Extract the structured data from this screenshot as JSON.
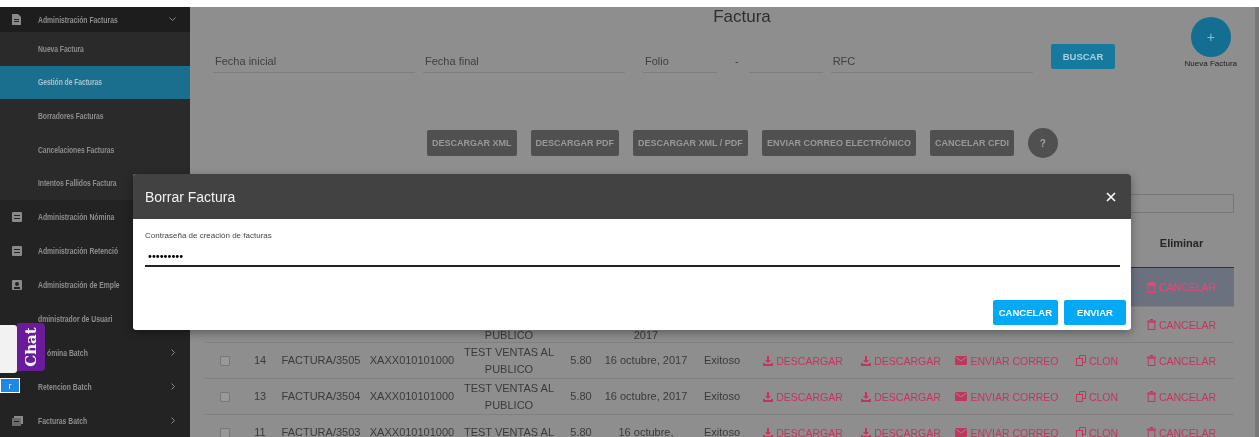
{
  "sidebar": {
    "items": [
      {
        "label": "Administración Facturas",
        "kind": "document",
        "expanded": true,
        "chevron": true,
        "children": [
          {
            "label": "Nueva Factura",
            "selected": false
          },
          {
            "label": "Gestión de Facturas",
            "selected": true
          },
          {
            "label": "Borradores Facturas",
            "selected": false
          },
          {
            "label": "Cancelaciones Facturas",
            "selected": false
          },
          {
            "label": "Intentos Fallidos Factura",
            "selected": false
          }
        ]
      },
      {
        "label": "Administración Nómina",
        "kind": "list"
      },
      {
        "label": "Administración Retenció",
        "kind": "list"
      },
      {
        "label": "Administración de Emple",
        "kind": "person"
      },
      {
        "label": "dministrador de Usuari",
        "kind": "none"
      },
      {
        "label": "ómina Batch",
        "kind": "covered",
        "expanded": false,
        "chevron": true
      },
      {
        "label": "Retencion Batch",
        "kind": "none",
        "expanded": false,
        "chevron": true
      },
      {
        "label": "Facturas Batch",
        "kind": "batch",
        "expanded": false,
        "chevron": true
      }
    ]
  },
  "chat": {
    "tab": "Chat",
    "button": "r"
  },
  "page": {
    "title": "Factura",
    "filters": [
      {
        "placeholder": "Fecha inicial",
        "kind": "wide"
      },
      {
        "placeholder": "Fecha final",
        "kind": "wide"
      },
      {
        "placeholder": "Folio",
        "kind": "short"
      },
      {
        "placeholder": "-",
        "kind": "dash"
      },
      {
        "kind": "short"
      },
      {
        "placeholder": "RFC",
        "kind": "wide"
      }
    ],
    "search_button": "BUSCAR",
    "fab": {
      "icon": "+",
      "label": "Nueva Factura"
    },
    "actions": [
      "DESCARGAR XML",
      "DESCARGAR PDF",
      "DESCARGAR XML / PDF",
      "ENVIAR CORREO ELECTRÓNICO",
      "CANCELAR CFDI"
    ],
    "help_button": "?"
  },
  "table": {
    "header": {
      "cancel": "Eliminar"
    },
    "rows": [
      {
        "selected": true,
        "cancel": "CANCELAR"
      },
      {
        "selected": false,
        "client": "PUBLICO",
        "date": "2017",
        "cancel": "CANCELAR"
      },
      {
        "selected": false,
        "checked": false,
        "number": "14",
        "folio": "FACTURA/3505",
        "rfc": "XAXX010101000",
        "client": "TEST VENTAS AL PUBLICO",
        "amount": "5.80",
        "date": "16 octubre, 2017",
        "status": "Exitoso",
        "xml": "DESCARGAR",
        "pdf": "DESCARGAR",
        "email": "ENVIAR CORREO",
        "clone": "CLON",
        "cancel": "CANCELAR"
      },
      {
        "selected": false,
        "checked": false,
        "number": "13",
        "folio": "FACTURA/3504",
        "rfc": "XAXX010101000",
        "client": "TEST VENTAS AL PUBLICO",
        "amount": "5.80",
        "date": "16 octubre, 2017",
        "status": "Exitoso",
        "xml": "DESCARGAR",
        "pdf": "DESCARGAR",
        "email": "ENVIAR CORREO",
        "clone": "CLON",
        "cancel": "CANCELAR"
      },
      {
        "selected": false,
        "checked": false,
        "number": "11",
        "folio": "FACTURA/3503",
        "rfc": "XAXX010101000",
        "client": "TEST VENTAS AL",
        "amount": "5.80",
        "date": "16 octubre,",
        "status": "Exitoso",
        "xml": "DESCARGAR",
        "pdf": "DESCARGAR",
        "email": "ENVIAR CORREO",
        "clone": "CLON",
        "cancel": "CANCELAR"
      }
    ]
  },
  "dialog": {
    "title": "Borrar Factura",
    "field_label": "Contraseña de creación de facturas",
    "field_value": "•••••••••",
    "buttons": [
      "CANCELAR",
      "ENVIAR"
    ]
  }
}
